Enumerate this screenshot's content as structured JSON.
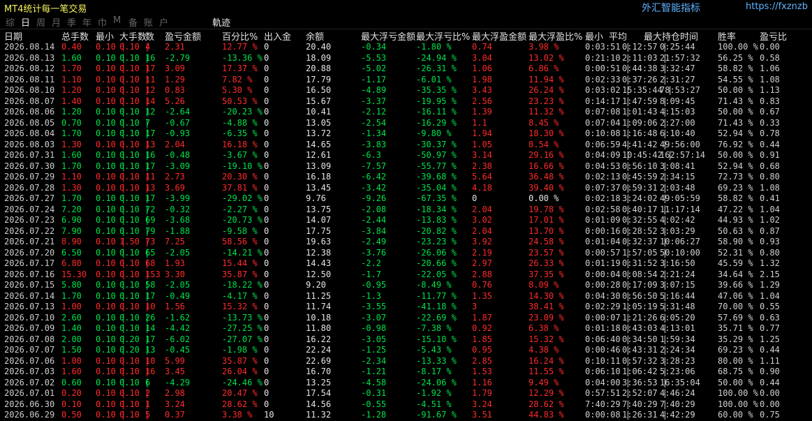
{
  "app": {
    "title": "MT4统计每一笔交易",
    "brand": "外汇智能指标",
    "site": "https://fxznzb"
  },
  "tabs": [
    "综",
    "日",
    "周",
    "月",
    "季",
    "年",
    "巾",
    "M",
    "备",
    "账",
    "户"
  ],
  "active_tab_index": 1,
  "mode_label": "軌迹",
  "headers": [
    "日期",
    "总手数",
    "最小",
    "大手数",
    "数",
    "盈亏金额",
    "百分比%",
    "出入金",
    "余额",
    "最大浮亏金额",
    "最大浮亏比%",
    "最大浮盈金额",
    "最大浮盈比%",
    "最小",
    "平均",
    "最大持仓时间",
    "胜率",
    "盈亏比"
  ],
  "colors": {
    "pos": "#00e24a",
    "neg": "#ff2a2a"
  },
  "rows": [
    {
      "s": "neg",
      "c": [
        "2026.08.14",
        "0.40",
        "0.10",
        "0.10",
        "4",
        "2.31",
        "12.77 %",
        "0",
        "20.40",
        "-0.34",
        "-1.80 %",
        "0.74",
        "3.98 %",
        "0:03:51",
        "0:12:57",
        "0:25:44",
        "100.00 %",
        "0.00"
      ]
    },
    {
      "s": "pos",
      "c": [
        "2026.08.13",
        "1.60",
        "0.10",
        "0.10",
        "16",
        "-2.79",
        "-13.36 %",
        "0",
        "18.09",
        "-5.53",
        "-24.94 %",
        "3.04",
        "13.02 %",
        "0:21:10",
        "2:11:03",
        "21:57:32",
        "56.25 %",
        "0.58"
      ]
    },
    {
      "s": "neg",
      "c": [
        "2026.08.12",
        "1.70",
        "0.10",
        "0.10",
        "17",
        "3.09",
        "17.37 %",
        "0",
        "20.88",
        "-5.02",
        "-26.31 %",
        "1.06",
        "6.86 %",
        "0:00:51",
        "0:44:38",
        "3:32:47",
        "58.82 %",
        "1.06"
      ]
    },
    {
      "s": "neg",
      "c": [
        "2026.08.11",
        "1.10",
        "0.10",
        "0.10",
        "11",
        "1.29",
        "7.82 %",
        "0",
        "17.79",
        "-1.17",
        "-6.01 %",
        "1.98",
        "11.94 %",
        "0:02:33",
        "0:37:26",
        "2:31:27",
        "54.55 %",
        "1.08"
      ]
    },
    {
      "s": "neg",
      "c": [
        "2026.08.10",
        "1.20",
        "0.10",
        "0.10",
        "12",
        "0.83",
        "5.30 %",
        "0",
        "16.50",
        "-4.89",
        "-35.35 %",
        "3.43",
        "26.24 %",
        "0:03:02",
        "15:35:44",
        "78:53:27",
        "50.00 %",
        "1.13"
      ]
    },
    {
      "s": "neg",
      "c": [
        "2026.08.07",
        "1.40",
        "0.10",
        "0.10",
        "14",
        "5.26",
        "50.53 %",
        "0",
        "15.67",
        "-3.37",
        "-19.95 %",
        "2.56",
        "23.23 %",
        "0:14:17",
        "1:47:59",
        "8:09:45",
        "71.43 %",
        "0.83"
      ]
    },
    {
      "s": "pos",
      "c": [
        "2026.08.06",
        "1.20",
        "0.10",
        "0.10",
        "12",
        "-2.64",
        "-20.23 %",
        "0",
        "10.41",
        "-2.12",
        "-16.11 %",
        "1.39",
        "11.32 %",
        "0:07:08",
        "1:01:43",
        "4:15:03",
        "50.00 %",
        "0.67"
      ]
    },
    {
      "s": "pos",
      "c": [
        "2026.08.05",
        "0.70",
        "0.10",
        "0.10",
        "7",
        "-0.67",
        "-4.88 %",
        "0",
        "13.05",
        "-2.54",
        "-16.29 %",
        "1.1",
        "8.45 %",
        "0:07:04",
        "1:09:06",
        "2:27:00",
        "71.43 %",
        "0.33"
      ]
    },
    {
      "s": "pos",
      "c": [
        "2026.08.04",
        "1.70",
        "0.10",
        "0.10",
        "17",
        "-0.93",
        "-6.35 %",
        "0",
        "13.72",
        "-1.34",
        "-9.80 %",
        "1.94",
        "18.30 %",
        "0:10:08",
        "1:16:48",
        "6:10:40",
        "52.94 %",
        "0.78"
      ]
    },
    {
      "s": "neg",
      "c": [
        "2026.08.03",
        "1.30",
        "0.10",
        "0.10",
        "13",
        "2.04",
        "16.18 %",
        "0",
        "14.65",
        "-3.83",
        "-30.37 %",
        "1.05",
        "8.54 %",
        "0:06:59",
        "4:41:42",
        "49:56:00",
        "76.92 %",
        "0.44"
      ]
    },
    {
      "s": "pos",
      "c": [
        "2026.07.31",
        "1.60",
        "0.10",
        "0.10",
        "16",
        "-0.48",
        "-3.67 %",
        "0",
        "12.61",
        "-6.3",
        "-50.97 %",
        "3.14",
        "29.16 %",
        "0:04:09",
        "10:45:42",
        "162:57:14",
        "50.00 %",
        "0.91"
      ]
    },
    {
      "s": "pos",
      "c": [
        "2026.07.30",
        "1.70",
        "0.10",
        "0.10",
        "17",
        "-3.09",
        "-19.10 %",
        "0",
        "13.09",
        "-7.57",
        "-55.77 %",
        "2.38",
        "16.66 %",
        "0:04:53",
        "0:56:10",
        "3:08:41",
        "52.94 %",
        "0.68"
      ]
    },
    {
      "s": "neg",
      "c": [
        "2026.07.29",
        "1.10",
        "0.10",
        "0.10",
        "11",
        "2.73",
        "20.30 %",
        "0",
        "16.18",
        "-6.42",
        "-39.68 %",
        "5.64",
        "36.48 %",
        "0:02:13",
        "0:45:59",
        "2:34:15",
        "72.73 %",
        "0.80"
      ]
    },
    {
      "s": "neg",
      "c": [
        "2026.07.28",
        "1.30",
        "0.10",
        "0.10",
        "13",
        "3.69",
        "37.81 %",
        "0",
        "13.45",
        "-3.42",
        "-35.04 %",
        "4.18",
        "39.40 %",
        "0:07:37",
        "0:59:31",
        "2:03:48",
        "69.23 %",
        "1.08"
      ]
    },
    {
      "s": "pos",
      "c": [
        "2026.07.27",
        "1.70",
        "0.10",
        "0.10",
        "17",
        "-3.99",
        "-29.02 %",
        "0",
        "9.76",
        "-9.26",
        "-67.35 %",
        "0",
        "0.00 %",
        "0:02:18",
        "3:24:02",
        "49:05:59",
        "58.82 %",
        "0.41"
      ]
    },
    {
      "s": "pos",
      "c": [
        "2026.07.24",
        "7.20",
        "0.10",
        "0.10",
        "72",
        "-0.32",
        "-2.27 %",
        "0",
        "13.75",
        "-2.08",
        "-18.34 %",
        "2.04",
        "19.78 %",
        "0:02:58",
        "0:40:17",
        "11:17:14",
        "47.22 %",
        "1.04"
      ]
    },
    {
      "s": "pos",
      "c": [
        "2026.07.23",
        "6.90",
        "0.10",
        "0.10",
        "69",
        "-3.68",
        "-20.73 %",
        "0",
        "14.07",
        "-2.44",
        "-13.83 %",
        "3.02",
        "17.01 %",
        "0:01:09",
        "0:32:55",
        "4:02:42",
        "44.93 %",
        "1.02"
      ]
    },
    {
      "s": "pos",
      "c": [
        "2026.07.22",
        "7.90",
        "0.10",
        "0.10",
        "79",
        "-1.88",
        "-9.58 %",
        "0",
        "17.75",
        "-3.84",
        "-20.82 %",
        "2.04",
        "13.70 %",
        "0:00:16",
        "0:28:52",
        "3:03:29",
        "50.63 %",
        "0.87"
      ]
    },
    {
      "s": "neg",
      "c": [
        "2026.07.21",
        "8.90",
        "0.10",
        "1.50",
        "73",
        "7.25",
        "58.56 %",
        "0",
        "19.63",
        "-2.49",
        "-23.23 %",
        "3.92",
        "24.58 %",
        "0:01:04",
        "0:32:37",
        "10:06:27",
        "58.90 %",
        "0.93"
      ]
    },
    {
      "s": "pos",
      "c": [
        "2026.07.20",
        "6.50",
        "0.10",
        "0.10",
        "65",
        "-2.05",
        "-14.21 %",
        "0",
        "12.38",
        "-3.76",
        "-26.06 %",
        "2.19",
        "23.57 %",
        "0:00:57",
        "1:57:05",
        "50:10:00",
        "52.31 %",
        "0.80"
      ]
    },
    {
      "s": "neg",
      "c": [
        "2026.07.17",
        "6.80",
        "0.10",
        "0.10",
        "68",
        "1.93",
        "15.44 %",
        "0",
        "14.43",
        "-2.2",
        "-20.66 %",
        "2.97",
        "26.33 %",
        "0:01:19",
        "0:31:52",
        "3:16:50",
        "45.59 %",
        "1.32"
      ]
    },
    {
      "s": "neg",
      "c": [
        "2026.07.16",
        "15.30",
        "0.10",
        "0.10",
        "153",
        "3.30",
        "35.87 %",
        "0",
        "12.50",
        "-1.7",
        "-22.05 %",
        "2.88",
        "37.35 %",
        "0:00:04",
        "0:08:54",
        "2:21:24",
        "34.64 %",
        "2.15"
      ]
    },
    {
      "s": "pos",
      "c": [
        "2026.07.15",
        "5.80",
        "0.10",
        "0.10",
        "58",
        "-2.05",
        "-18.22 %",
        "0",
        "9.20",
        "-0.95",
        "-8.49 %",
        "0.76",
        "8.09 %",
        "0:00:28",
        "0:17:09",
        "3:07:15",
        "39.66 %",
        "1.29"
      ]
    },
    {
      "s": "pos",
      "c": [
        "2026.07.14",
        "1.70",
        "0.10",
        "0.10",
        "17",
        "-0.49",
        "-4.17 %",
        "0",
        "11.25",
        "-1.3",
        "-11.77 %",
        "1.35",
        "14.30 %",
        "0:04:30",
        "0:56:50",
        "5:16:44",
        "47.06 %",
        "1.04"
      ]
    },
    {
      "s": "neg",
      "c": [
        "2026.07.13",
        "1.00",
        "0.10",
        "0.10",
        "10",
        "1.56",
        "15.32 %",
        "0",
        "11.74",
        "-3.55",
        "-41.18 %",
        "3",
        "38.41 %",
        "0:02:29",
        "1:05:19",
        "5:31:48",
        "70.00 %",
        "0.55"
      ]
    },
    {
      "s": "pos",
      "c": [
        "2026.07.10",
        "2.60",
        "0.10",
        "0.10",
        "26",
        "-1.62",
        "-13.73 %",
        "0",
        "10.18",
        "-3.07",
        "-22.69 %",
        "1.87",
        "23.09 %",
        "0:00:07",
        "1:21:26",
        "6:05:20",
        "57.69 %",
        "0.63"
      ]
    },
    {
      "s": "pos",
      "c": [
        "2026.07.09",
        "1.40",
        "0.10",
        "0.10",
        "14",
        "-4.42",
        "-27.25 %",
        "0",
        "11.80",
        "-0.98",
        "-7.38 %",
        "0.92",
        "6.38 %",
        "0:01:18",
        "0:43:03",
        "4:13:01",
        "35.71 %",
        "0.77"
      ]
    },
    {
      "s": "pos",
      "c": [
        "2026.07.08",
        "2.00",
        "0.10",
        "0.20",
        "17",
        "-6.02",
        "-27.07 %",
        "0",
        "16.22",
        "-3.05",
        "-15.10 %",
        "1.85",
        "15.32 %",
        "0:06:40",
        "0:34:50",
        "1:59:34",
        "35.29 %",
        "1.25"
      ]
    },
    {
      "s": "pos",
      "c": [
        "2026.07.07",
        "1.50",
        "0.10",
        "0.20",
        "13",
        "-0.45",
        "-1.98 %",
        "0",
        "22.24",
        "-1.25",
        "-5.43 %",
        "0.95",
        "4.38 %",
        "0:00:46",
        "0:43:31",
        "2:24:34",
        "69.23 %",
        "0.44"
      ]
    },
    {
      "s": "neg",
      "c": [
        "2026.07.06",
        "1.00",
        "0.10",
        "0.10",
        "10",
        "5.99",
        "35.87 %",
        "0",
        "22.69",
        "-2.34",
        "-13.33 %",
        "2.85",
        "16.24 %",
        "0:10:11",
        "0:57:32",
        "3:28:23",
        "80.00 %",
        "1.11"
      ]
    },
    {
      "s": "neg",
      "c": [
        "2026.07.03",
        "1.60",
        "0.10",
        "0.10",
        "16",
        "3.45",
        "26.04 %",
        "0",
        "16.70",
        "-1.21",
        "-8.17 %",
        "1.53",
        "11.55 %",
        "0:06:10",
        "1:06:42",
        "5:23:06",
        "68.75 %",
        "0.90"
      ]
    },
    {
      "s": "pos",
      "c": [
        "2026.07.02",
        "0.60",
        "0.10",
        "0.10",
        "6",
        "-4.29",
        "-24.46 %",
        "0",
        "13.25",
        "-4.58",
        "-24.06 %",
        "1.16",
        "9.49 %",
        "0:04:00",
        "3:36:53",
        "16:35:04",
        "50.00 %",
        "0.44"
      ]
    },
    {
      "s": "neg",
      "c": [
        "2026.07.01",
        "0.20",
        "0.10",
        "0.10",
        "2",
        "2.98",
        "20.47 %",
        "0",
        "17.54",
        "-0.31",
        "-1.92 %",
        "1.79",
        "12.29 %",
        "0:57:51",
        "2:52:07",
        "4:46:24",
        "100.00 %",
        "0.00"
      ]
    },
    {
      "s": "neg",
      "c": [
        "2026.06.30",
        "0.10",
        "0.10",
        "0.10",
        "1",
        "3.24",
        "28.62 %",
        "0",
        "14.56",
        "-0.55",
        "-4.51 %",
        "3.24",
        "28.62 %",
        "7:40:29",
        "7:40:29",
        "7:40:29",
        "100.00 %",
        "0.00"
      ]
    },
    {
      "s": "neg",
      "c": [
        "2026.06.29",
        "0.50",
        "0.10",
        "0.10",
        "5",
        "0.37",
        "3.38 %",
        "10",
        "11.32",
        "-1.28",
        "-91.67 %",
        "3.51",
        "44.83 %",
        "0:00:08",
        "1:26:31",
        "4:42:29",
        "60.00 %",
        "0.75"
      ]
    }
  ]
}
